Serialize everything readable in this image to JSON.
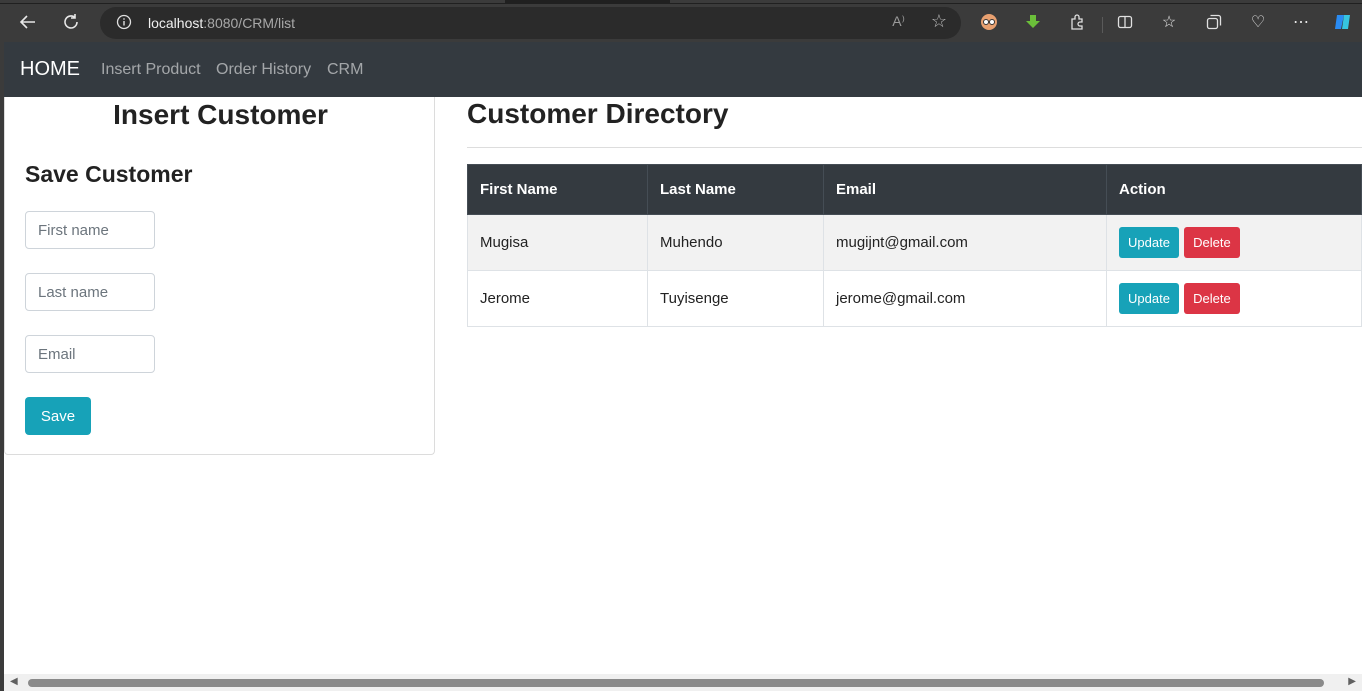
{
  "browser": {
    "url_host": "localhost",
    "url_rest": ":8080/CRM/list",
    "read_aloud": "A⁾",
    "icons": [
      "back-icon",
      "refresh-icon",
      "info-icon",
      "read-aloud-icon",
      "favorite-star-icon",
      "profile-icon",
      "download-icon",
      "extensions-icon",
      "split-screen-icon",
      "favorites-icon",
      "collections-icon",
      "browser-essentials-icon",
      "more-icon",
      "copilot-icon"
    ]
  },
  "navbar": {
    "brand": "HOME",
    "links": [
      "Insert Product",
      "Order History",
      "CRM"
    ]
  },
  "form": {
    "title": "Insert Customer",
    "subtitle": "Save Customer",
    "first_name_placeholder": "First name",
    "last_name_placeholder": "Last name",
    "email_placeholder": "Email",
    "save_label": "Save"
  },
  "directory": {
    "title": "Customer Directory",
    "columns": [
      "First Name",
      "Last Name",
      "Email",
      "Action"
    ],
    "rows": [
      {
        "first": "Mugisa",
        "last": "Muhendo",
        "email": "mugijnt@gmail.com"
      },
      {
        "first": "Jerome",
        "last": "Tuyisenge",
        "email": "jerome@gmail.com"
      }
    ],
    "update_label": "Update",
    "delete_label": "Delete"
  },
  "colors": {
    "navbar": "#343a40",
    "info": "#17a2b8",
    "danger": "#dc3545"
  }
}
